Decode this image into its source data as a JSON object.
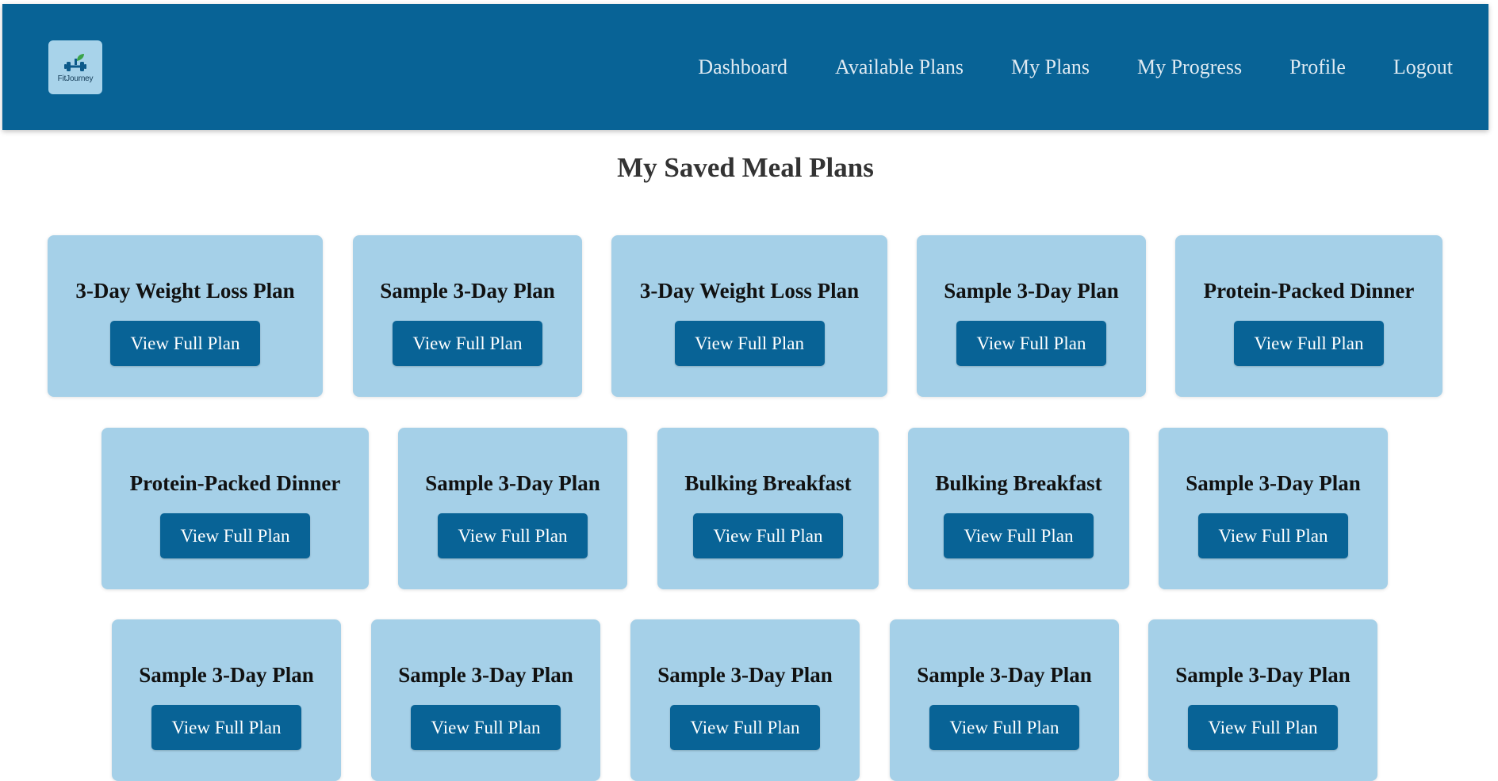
{
  "brand": {
    "name": "FitJourney"
  },
  "nav": {
    "links": [
      "Dashboard",
      "Available Plans",
      "My Plans",
      "My Progress",
      "Profile",
      "Logout"
    ]
  },
  "page": {
    "title": "My Saved Meal Plans"
  },
  "plans": [
    {
      "title": "3-Day Weight Loss Plan",
      "button": "View Full Plan"
    },
    {
      "title": "Sample 3-Day Plan",
      "button": "View Full Plan"
    },
    {
      "title": "3-Day Weight Loss Plan",
      "button": "View Full Plan"
    },
    {
      "title": "Sample 3-Day Plan",
      "button": "View Full Plan"
    },
    {
      "title": "Protein-Packed Dinner",
      "button": "View Full Plan"
    },
    {
      "title": "Protein-Packed Dinner",
      "button": "View Full Plan"
    },
    {
      "title": "Sample 3-Day Plan",
      "button": "View Full Plan"
    },
    {
      "title": "Bulking Breakfast",
      "button": "View Full Plan"
    },
    {
      "title": "Bulking Breakfast",
      "button": "View Full Plan"
    },
    {
      "title": "Sample 3-Day Plan",
      "button": "View Full Plan"
    },
    {
      "title": "Sample 3-Day Plan",
      "button": "View Full Plan"
    },
    {
      "title": "Sample 3-Day Plan",
      "button": "View Full Plan"
    },
    {
      "title": "Sample 3-Day Plan",
      "button": "View Full Plan"
    },
    {
      "title": "Sample 3-Day Plan",
      "button": "View Full Plan"
    },
    {
      "title": "Sample 3-Day Plan",
      "button": "View Full Plan"
    }
  ],
  "colors": {
    "navbar": "#086396",
    "card": "#a5d0e8",
    "button": "#086396"
  }
}
